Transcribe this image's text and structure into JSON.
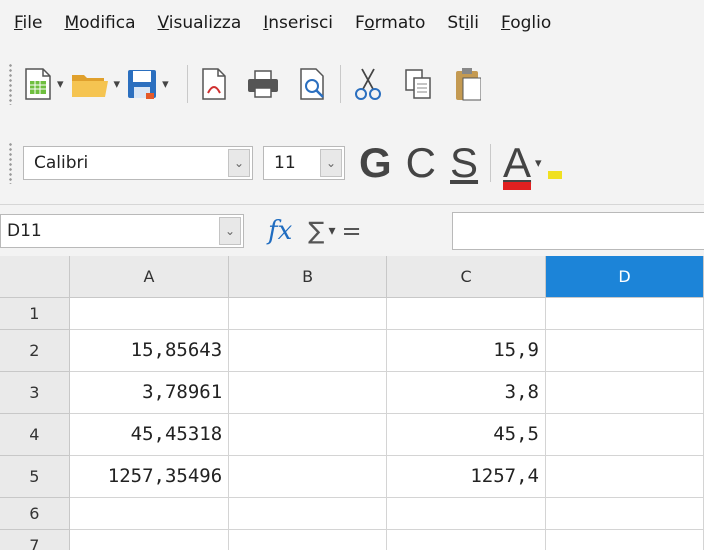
{
  "menu": {
    "items": [
      {
        "label": "File",
        "accel": "F",
        "rest": "ile"
      },
      {
        "label": "Modifica",
        "accel": "M",
        "rest": "odifica"
      },
      {
        "label": "Visualizza",
        "accel": "V",
        "rest": "isualizza"
      },
      {
        "label": "Inserisci",
        "accel": "I",
        "rest": "nserisci"
      },
      {
        "label": "Formato",
        "pre": "F",
        "accel": "o",
        "rest": "rmato"
      },
      {
        "label": "Stili",
        "pre": "St",
        "accel": "i",
        "rest": "li"
      },
      {
        "label": "Foglio",
        "accel": "F",
        "rest": "oglio"
      }
    ]
  },
  "format_toolbar": {
    "font_name": "Calibri",
    "font_size": "11",
    "bold_label": "G",
    "italic_label": "C",
    "underline_label": "S",
    "font_color_label": "A"
  },
  "formula_bar": {
    "name_box": "D11",
    "fx_label": "fx",
    "sum_label": "∑",
    "equals_label": "=",
    "formula": ""
  },
  "sheet": {
    "columns": [
      "A",
      "B",
      "C",
      "D"
    ],
    "selected_column": "D",
    "rows": [
      {
        "num": "1",
        "A": "",
        "B": "",
        "C": "",
        "D": ""
      },
      {
        "num": "2",
        "A": "15,85643",
        "B": "",
        "C": "15,9",
        "D": ""
      },
      {
        "num": "3",
        "A": "3,78961",
        "B": "",
        "C": "3,8",
        "D": ""
      },
      {
        "num": "4",
        "A": "45,45318",
        "B": "",
        "C": "45,5",
        "D": ""
      },
      {
        "num": "5",
        "A": "1257,35496",
        "B": "",
        "C": "1257,4",
        "D": ""
      },
      {
        "num": "6",
        "A": "",
        "B": "",
        "C": "",
        "D": ""
      },
      {
        "num": "7",
        "A": "",
        "B": "",
        "C": "",
        "D": ""
      }
    ]
  },
  "colors": {
    "selected_header": "#1c84d8",
    "font_color_bar": "#e02020",
    "highlight_bar": "#f0e020"
  }
}
